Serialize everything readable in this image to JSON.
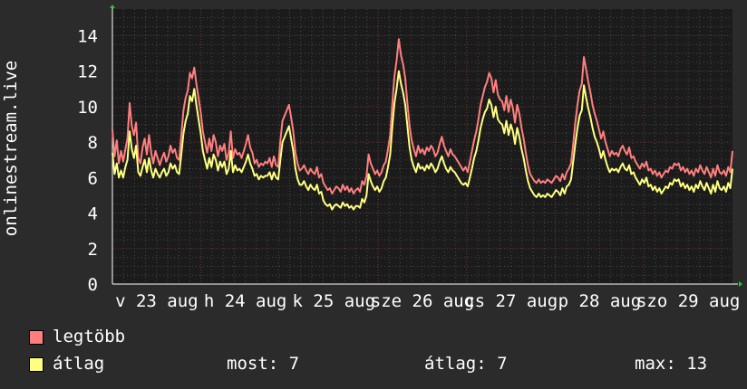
{
  "chart_data": {
    "type": "line",
    "ylabel": "onlinestream.live",
    "ylim": [
      0,
      15.5
    ],
    "yticks": [
      0,
      2,
      4,
      6,
      8,
      10,
      12,
      14
    ],
    "x_tick_labels": [
      "v 23 aug",
      "h 24 aug",
      "k 25 aug",
      "sze 26 aug",
      "cs 27 aug",
      "p 28 aug",
      "szo 29 aug"
    ],
    "grid": true,
    "series": [
      {
        "name": "legtöbb",
        "color": "#ff7f7f",
        "values": [
          8.7,
          7.2,
          8.1,
          6.8,
          7.5,
          6.9,
          7.6,
          8.2,
          10.2,
          8.9,
          8.4,
          9.1,
          7.1,
          6.8,
          7.7,
          8.2,
          7.3,
          8.4,
          7.4,
          6.8,
          7.5,
          7.1,
          6.7,
          7.1,
          7.4,
          6.9,
          7.2,
          7.8,
          7.4,
          7.6,
          7.1,
          7.0,
          8.4,
          9.8,
          10.5,
          10.9,
          11.9,
          11.6,
          12.2,
          11.3,
          10.5,
          9.7,
          8.6,
          8.0,
          7.4,
          8.2,
          7.5,
          8.4,
          8.0,
          7.2,
          7.8,
          7.5,
          7.9,
          7.0,
          7.4,
          8.6,
          7.1,
          7.6,
          7.3,
          7.4,
          7.1,
          7.5,
          7.9,
          8.4,
          7.7,
          7.4,
          6.8,
          7.0,
          6.6,
          6.8,
          6.7,
          6.9,
          6.8,
          7.1,
          6.6,
          7.2,
          6.7,
          6.6,
          8.1,
          9.2,
          9.5,
          9.8,
          10.1,
          9.4,
          8.6,
          7.4,
          6.8,
          6.4,
          6.5,
          6.7,
          6.4,
          6.2,
          6.5,
          6.3,
          6.2,
          6.6,
          6.0,
          6.2,
          5.7,
          5.5,
          5.3,
          5.4,
          5.1,
          5.3,
          5.5,
          5.4,
          5.2,
          5.6,
          5.3,
          5.5,
          5.2,
          5.4,
          5.1,
          5.3,
          5.4,
          5.2,
          5.8,
          5.6,
          6.1,
          7.3,
          6.8,
          6.5,
          6.2,
          6.4,
          6.1,
          6.3,
          6.7,
          6.9,
          7.6,
          8.4,
          10.2,
          11.7,
          12.6,
          13.8,
          12.9,
          12.4,
          11.6,
          10.2,
          8.9,
          8.1,
          7.6,
          7.2,
          7.8,
          7.4,
          7.6,
          7.3,
          7.7,
          7.5,
          7.8,
          7.6,
          7.2,
          7.4,
          7.9,
          8.3,
          7.8,
          7.5,
          7.2,
          7.6,
          7.3,
          7.2,
          7.0,
          6.8,
          6.6,
          6.4,
          6.6,
          6.3,
          6.9,
          7.5,
          8.1,
          8.6,
          9.3,
          10.1,
          10.6,
          11.1,
          11.4,
          11.9,
          11.6,
          10.8,
          11.5,
          10.7,
          10.4,
          10.3,
          9.8,
          10.6,
          9.7,
          10.4,
          9.9,
          9.1,
          10.1,
          9.6,
          8.8,
          8.2,
          7.4,
          6.7,
          6.2,
          6.0,
          5.8,
          5.7,
          5.9,
          5.7,
          5.8,
          5.7,
          5.9,
          5.8,
          5.7,
          5.9,
          6.1,
          6.0,
          5.8,
          6.2,
          5.9,
          6.3,
          6.5,
          6.8,
          7.9,
          9.1,
          10.1,
          10.9,
          11.3,
          12.8,
          12.1,
          11.4,
          10.8,
          10.1,
          9.6,
          9.2,
          8.7,
          8.2,
          8.6,
          8.0,
          7.6,
          7.2,
          7.5,
          7.3,
          7.4,
          7.2,
          7.6,
          7.8,
          7.5,
          7.3,
          7.7,
          7.1,
          7.2,
          6.9,
          6.7,
          6.5,
          6.8,
          6.6,
          6.9,
          6.4,
          6.5,
          6.2,
          6.4,
          6.1,
          6.3,
          6.0,
          6.2,
          6.4,
          6.3,
          6.6,
          6.5,
          6.8,
          6.7,
          6.8,
          6.4,
          6.6,
          6.3,
          6.5,
          6.2,
          6.4,
          6.1,
          6.5,
          6.3,
          6.7,
          6.4,
          6.2,
          6.6,
          6.3,
          6.0,
          6.5,
          6.1,
          6.7,
          6.3,
          6.2,
          6.4,
          6.1,
          6.6,
          6.3,
          7.5
        ]
      },
      {
        "name": "átlag",
        "color": "#ffff80",
        "values": [
          7.4,
          6.2,
          6.8,
          6.0,
          6.4,
          6.0,
          6.6,
          7.0,
          8.6,
          7.6,
          7.1,
          7.8,
          6.3,
          6.1,
          6.6,
          7.0,
          6.3,
          7.1,
          6.4,
          6.0,
          6.5,
          6.2,
          6.0,
          6.3,
          6.5,
          6.1,
          6.3,
          6.8,
          6.5,
          6.7,
          6.3,
          6.2,
          7.3,
          8.5,
          9.2,
          9.6,
          10.6,
          10.3,
          11.0,
          10.1,
          9.3,
          8.5,
          7.5,
          7.0,
          6.5,
          7.1,
          6.6,
          7.3,
          7.0,
          6.4,
          6.9,
          6.6,
          6.9,
          6.2,
          6.5,
          7.5,
          6.3,
          6.7,
          6.4,
          6.5,
          6.3,
          6.6,
          6.9,
          7.3,
          6.8,
          6.5,
          6.1,
          6.2,
          5.9,
          6.1,
          6.0,
          6.1,
          6.1,
          6.3,
          5.9,
          6.3,
          6.0,
          5.9,
          7.0,
          8.0,
          8.3,
          8.6,
          8.9,
          8.2,
          7.5,
          6.5,
          5.9,
          5.6,
          5.6,
          5.8,
          5.5,
          5.3,
          5.6,
          5.4,
          5.3,
          5.6,
          5.1,
          5.2,
          4.7,
          4.5,
          4.4,
          4.5,
          4.2,
          4.4,
          4.5,
          4.4,
          4.3,
          4.6,
          4.4,
          4.5,
          4.3,
          4.4,
          4.2,
          4.4,
          4.4,
          4.3,
          4.8,
          4.6,
          5.0,
          6.2,
          5.8,
          5.5,
          5.3,
          5.5,
          5.2,
          5.4,
          5.8,
          6.0,
          6.6,
          7.3,
          8.9,
          10.2,
          11.0,
          12.0,
          11.3,
          10.8,
          10.1,
          8.9,
          7.7,
          7.0,
          6.6,
          6.3,
          6.8,
          6.5,
          6.6,
          6.4,
          6.7,
          6.5,
          6.8,
          6.6,
          6.3,
          6.5,
          6.9,
          7.2,
          6.8,
          6.5,
          6.3,
          6.6,
          6.4,
          6.3,
          6.1,
          5.9,
          5.7,
          5.6,
          5.7,
          5.5,
          6.0,
          6.5,
          7.1,
          7.5,
          8.1,
          8.8,
          9.3,
          9.7,
          9.9,
          10.4,
          10.1,
          9.4,
          10.0,
          9.3,
          9.1,
          9.0,
          8.5,
          9.2,
          8.4,
          9.0,
          8.6,
          7.9,
          8.8,
          8.3,
          7.6,
          7.1,
          6.4,
          5.8,
          5.4,
          5.2,
          5.0,
          4.9,
          5.1,
          4.9,
          5.0,
          4.9,
          5.1,
          5.0,
          4.9,
          5.1,
          5.3,
          5.2,
          5.0,
          5.4,
          5.1,
          5.5,
          5.6,
          5.9,
          6.9,
          7.9,
          8.8,
          9.5,
          9.8,
          11.2,
          10.5,
          9.9,
          9.4,
          8.8,
          8.3,
          8.0,
          7.6,
          7.1,
          7.5,
          7.0,
          6.6,
          6.3,
          6.5,
          6.4,
          6.5,
          6.3,
          6.6,
          6.8,
          6.5,
          6.4,
          6.7,
          6.2,
          6.3,
          6.0,
          5.8,
          5.6,
          5.9,
          5.7,
          6.0,
          5.5,
          5.6,
          5.3,
          5.5,
          5.2,
          5.4,
          5.1,
          5.3,
          5.5,
          5.4,
          5.7,
          5.6,
          5.9,
          5.8,
          5.9,
          5.5,
          5.7,
          5.4,
          5.6,
          5.3,
          5.5,
          5.2,
          5.6,
          5.4,
          5.8,
          5.5,
          5.3,
          5.7,
          5.4,
          5.1,
          5.6,
          5.2,
          5.8,
          5.4,
          5.3,
          5.5,
          5.2,
          5.7,
          5.4,
          6.5
        ]
      }
    ]
  },
  "legend": {
    "items": [
      {
        "label": "legtöbb",
        "color": "#ff7f7f"
      },
      {
        "label": "átlag",
        "color": "#ffff80"
      }
    ],
    "stats": {
      "most": "most: 7",
      "atlag": "átlag: 7",
      "max": "max: 13"
    }
  }
}
